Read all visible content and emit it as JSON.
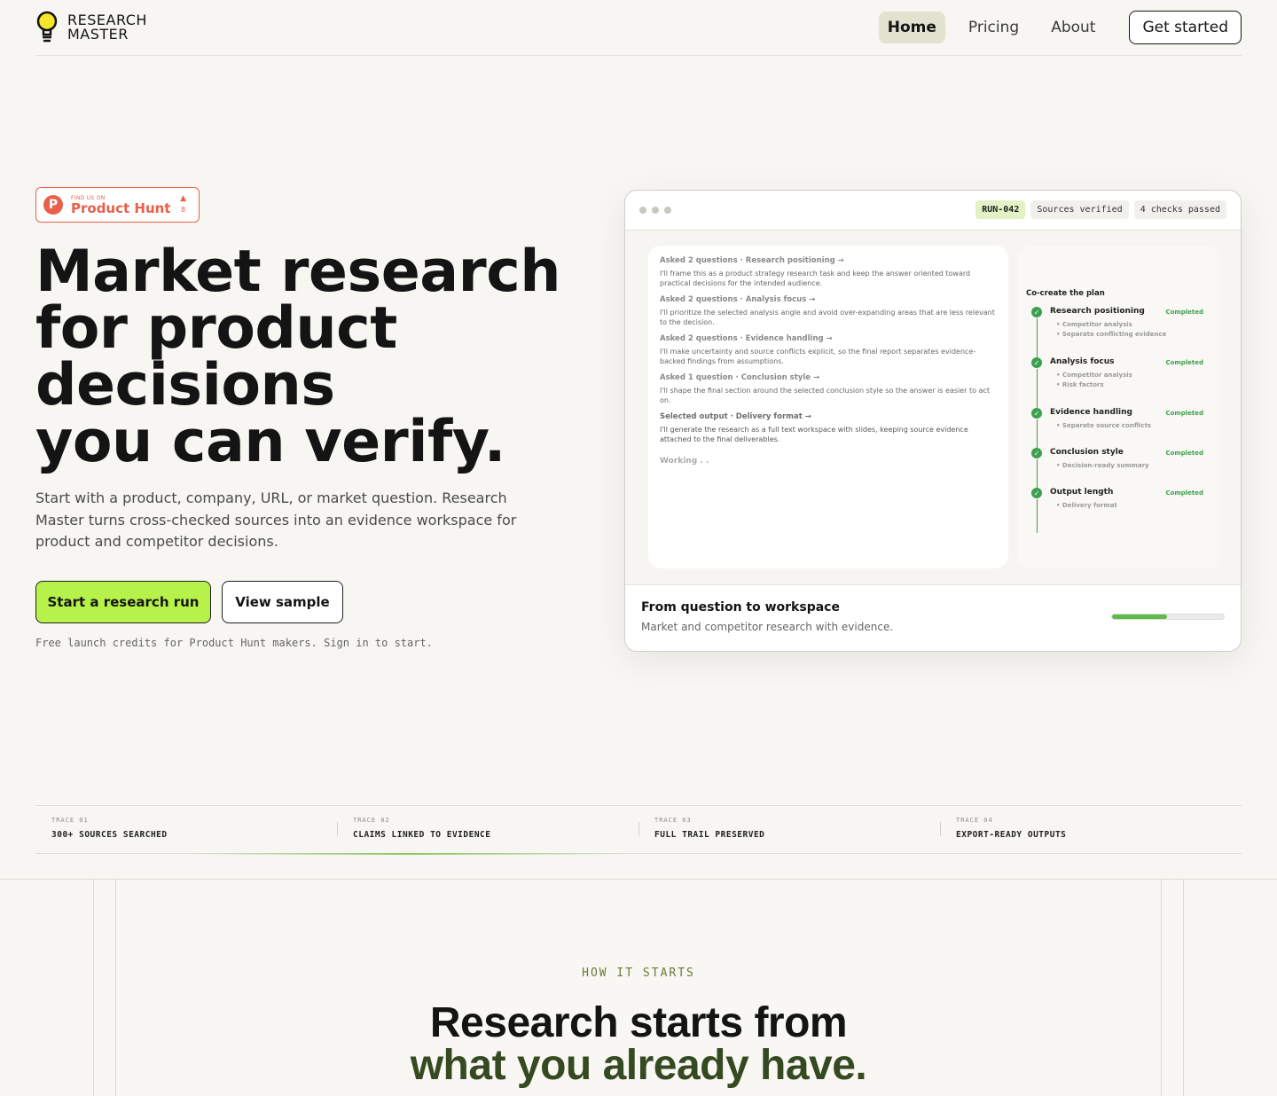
{
  "brand": {
    "line1": "RESEARCH",
    "line2": "MASTER"
  },
  "nav": {
    "items": [
      {
        "label": "Home",
        "active": true
      },
      {
        "label": "Pricing",
        "active": false
      },
      {
        "label": "About",
        "active": false
      }
    ],
    "cta": "Get started"
  },
  "badge": {
    "small": "FIND US ON",
    "name": "Product Hunt",
    "votes": "8"
  },
  "hero": {
    "title_lines": [
      "Market research",
      "for product",
      "decisions",
      "you can verify."
    ],
    "subtitle": "Start with a product, company, URL, or market question. Research Master turns cross-checked sources into an evidence workspace for product and competitor decisions.",
    "primary_cta": "Start a research run",
    "secondary_cta": "View sample",
    "note": "Free launch credits for Product Hunt makers. Sign in to start."
  },
  "app": {
    "chips": [
      "RUN-042",
      "Sources verified",
      "4 checks passed"
    ],
    "chat": [
      {
        "head": "Asked 2 questions · Research positioning →",
        "body": "I'll frame this as a product strategy research task and keep the answer oriented toward practical decisions for the intended audience."
      },
      {
        "head": "Asked 2 questions · Analysis focus →",
        "body": "I'll prioritize the selected analysis angle and avoid over-expanding areas that are less relevant to the decision."
      },
      {
        "head": "Asked 2 questions · Evidence handling →",
        "body": "I'll make uncertainty and source conflicts explicit, so the final report separates evidence-backed findings from assumptions."
      },
      {
        "head": "Asked 1 question · Conclusion style →",
        "body": "I'll shape the final section around the selected conclusion style so the answer is easier to act on."
      },
      {
        "head": "Selected output · Delivery format →",
        "body": "I'll generate the research as a full text workspace with slides, keeping source evidence attached to the final deliverables."
      }
    ],
    "working": "Working . .",
    "plan": {
      "title": "Co-create the plan",
      "items": [
        {
          "name": "Research positioning",
          "status": "Completed",
          "subs": [
            "Competitor analysis",
            "Separate conflicting evidence"
          ]
        },
        {
          "name": "Analysis focus",
          "status": "Completed",
          "subs": [
            "Competitor analysis",
            "Risk factors"
          ]
        },
        {
          "name": "Evidence handling",
          "status": "Completed",
          "subs": [
            "Separate source conflicts"
          ]
        },
        {
          "name": "Conclusion style",
          "status": "Completed",
          "subs": [
            "Decision-ready summary"
          ]
        },
        {
          "name": "Output length",
          "status": "Completed",
          "subs": [
            "Delivery format"
          ]
        }
      ]
    },
    "footer": {
      "title": "From question to workspace",
      "subtitle": "Market and competitor research with evidence.",
      "progress": 0.49
    }
  },
  "traces": [
    {
      "key": "TRACE 01",
      "value": "300+ SOURCES SEARCHED"
    },
    {
      "key": "TRACE 02",
      "value": "CLAIMS LINKED TO EVIDENCE"
    },
    {
      "key": "TRACE 03",
      "value": "FULL TRAIL PRESERVED"
    },
    {
      "key": "TRACE 04",
      "value": "EXPORT-READY OUTPUTS"
    }
  ],
  "section2": {
    "eyebrow": "HOW IT STARTS",
    "heading_line1": "Research starts from",
    "heading_line2": "what you already have."
  },
  "colors": {
    "accent": "#b6f24a",
    "success": "#3d9f4f",
    "producthunt": "#e8604a",
    "heading_green": "#364a22"
  }
}
